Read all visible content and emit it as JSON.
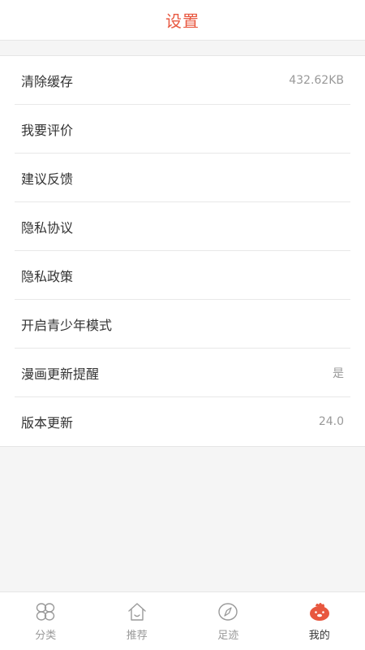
{
  "header": {
    "title": "设置"
  },
  "settings": [
    {
      "label": "清除缓存",
      "value": "432.62KB"
    },
    {
      "label": "我要评价",
      "value": ""
    },
    {
      "label": "建议反馈",
      "value": ""
    },
    {
      "label": "隐私协议",
      "value": ""
    },
    {
      "label": "隐私政策",
      "value": ""
    },
    {
      "label": "开启青少年模式",
      "value": ""
    },
    {
      "label": "漫画更新提醒",
      "value": "是"
    },
    {
      "label": "版本更新",
      "value": "24.0"
    }
  ],
  "tabbar": {
    "active_index": 3,
    "accent": "#e8573f",
    "items": [
      {
        "label": "分类",
        "icon": "grid-clover-icon"
      },
      {
        "label": "推荐",
        "icon": "home-icon"
      },
      {
        "label": "足迹",
        "icon": "compass-icon"
      },
      {
        "label": "我的",
        "icon": "mascot-face-icon"
      }
    ]
  }
}
